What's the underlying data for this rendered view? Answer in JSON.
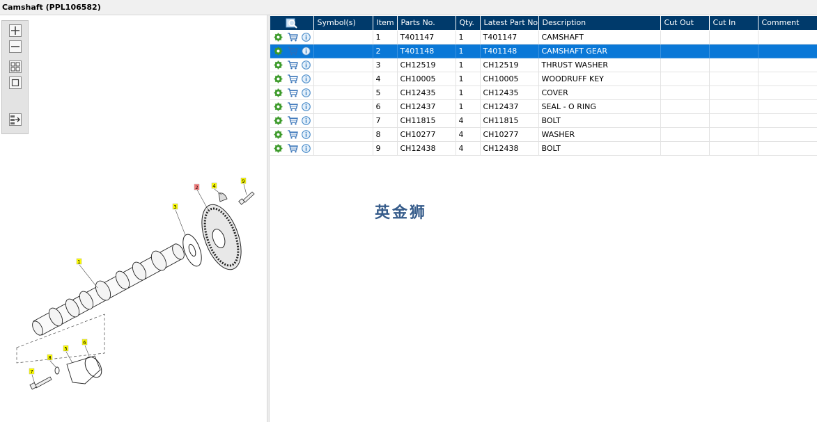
{
  "window": {
    "title": "Camshaft (PPL106582)"
  },
  "toolbar": {
    "icons": [
      "zoom-in-icon",
      "zoom-out-icon",
      "fit-all-icon",
      "actual-size-icon",
      "export-icon"
    ]
  },
  "diagram": {
    "callouts": [
      {
        "label": "1",
        "highlight": "#ffff00"
      },
      {
        "label": "2",
        "highlight": "#ff8080"
      },
      {
        "label": "3",
        "highlight": "#ffff00"
      },
      {
        "label": "4",
        "highlight": "#ffff00"
      },
      {
        "label": "5",
        "highlight": "#ffff00"
      },
      {
        "label": "6",
        "highlight": "#ffff00"
      },
      {
        "label": "7",
        "highlight": "#ffff00"
      },
      {
        "label": "8",
        "highlight": "#ffff00"
      },
      {
        "label": "9",
        "highlight": "#ffff00"
      }
    ]
  },
  "table": {
    "header_icon": "search-parts-icon",
    "columns": [
      "Symbol(s)",
      "Item",
      "Parts No.",
      "Qty.",
      "Latest Part No.",
      "Description",
      "Cut Out",
      "Cut In",
      "Comment"
    ],
    "selected_row": 1,
    "rows": [
      {
        "symbols": "",
        "item": "1",
        "part_no": "T401147",
        "qty": "1",
        "latest_part_no": "T401147",
        "description": "CAMSHAFT",
        "cut_out": "",
        "cut_in": "",
        "comment": ""
      },
      {
        "symbols": "",
        "item": "2",
        "part_no": "T401148",
        "qty": "1",
        "latest_part_no": "T401148",
        "description": "CAMSHAFT GEAR",
        "cut_out": "",
        "cut_in": "",
        "comment": ""
      },
      {
        "symbols": "",
        "item": "3",
        "part_no": "CH12519",
        "qty": "1",
        "latest_part_no": "CH12519",
        "description": "THRUST WASHER",
        "cut_out": "",
        "cut_in": "",
        "comment": ""
      },
      {
        "symbols": "",
        "item": "4",
        "part_no": "CH10005",
        "qty": "1",
        "latest_part_no": "CH10005",
        "description": "WOODRUFF KEY",
        "cut_out": "",
        "cut_in": "",
        "comment": ""
      },
      {
        "symbols": "",
        "item": "5",
        "part_no": "CH12435",
        "qty": "1",
        "latest_part_no": "CH12435",
        "description": "COVER",
        "cut_out": "",
        "cut_in": "",
        "comment": ""
      },
      {
        "symbols": "",
        "item": "6",
        "part_no": "CH12437",
        "qty": "1",
        "latest_part_no": "CH12437",
        "description": "SEAL - O RING",
        "cut_out": "",
        "cut_in": "",
        "comment": ""
      },
      {
        "symbols": "",
        "item": "7",
        "part_no": "CH11815",
        "qty": "4",
        "latest_part_no": "CH11815",
        "description": "BOLT",
        "cut_out": "",
        "cut_in": "",
        "comment": ""
      },
      {
        "symbols": "",
        "item": "8",
        "part_no": "CH10277",
        "qty": "4",
        "latest_part_no": "CH10277",
        "description": "WASHER",
        "cut_out": "",
        "cut_in": "",
        "comment": ""
      },
      {
        "symbols": "",
        "item": "9",
        "part_no": "CH12438",
        "qty": "4",
        "latest_part_no": "CH12438",
        "description": "BOLT",
        "cut_out": "",
        "cut_in": "",
        "comment": ""
      }
    ],
    "row_icons": [
      "settings-gear-icon",
      "add-to-cart-icon",
      "info-icon"
    ]
  },
  "watermark": {
    "text": "英金狮"
  },
  "colors": {
    "header_bg": "#003a6b",
    "selected_row": "#0a78d7",
    "gear_green": "#3c9a2a",
    "info_blue": "#3b82c4"
  }
}
